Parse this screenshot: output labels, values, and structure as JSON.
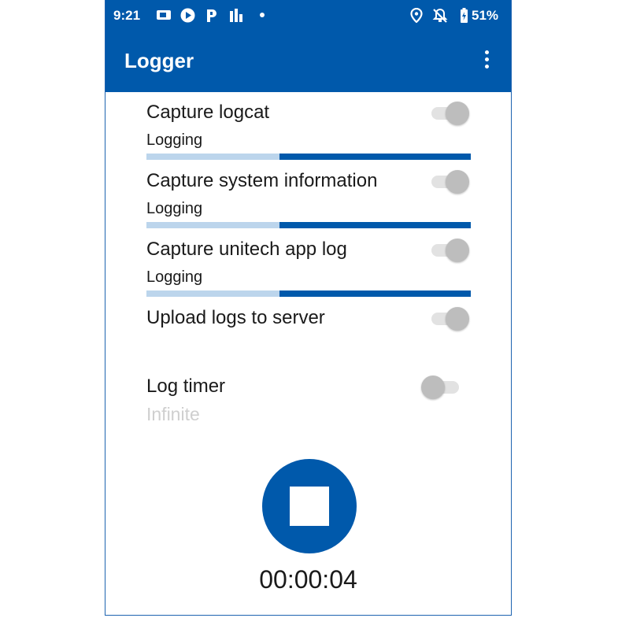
{
  "statusbar": {
    "time": "9:21",
    "battery": "51%",
    "left_icons": [
      "video-icon",
      "play-icon",
      "parking-icon",
      "chart-icon",
      "dot-icon"
    ],
    "right_icons": [
      "location-icon",
      "bell-off-icon",
      "battery-icon"
    ]
  },
  "appbar": {
    "title": "Logger",
    "menu_icon": "overflow-menu-icon"
  },
  "settings": [
    {
      "label": "Capture logcat",
      "sub": "Logging",
      "enabled": true,
      "progress": 0.41
    },
    {
      "label": "Capture system information",
      "sub": "Logging",
      "enabled": true,
      "progress": 0.41
    },
    {
      "label": "Capture unitech app log",
      "sub": "Logging",
      "enabled": true,
      "progress": 0.41
    },
    {
      "label": "Upload logs to server",
      "enabled": true
    }
  ],
  "log_timer": {
    "label": "Log timer",
    "sub": "Infinite",
    "enabled": false
  },
  "stop_button": {
    "icon": "stop-icon"
  },
  "elapsed": "00:00:04",
  "colors": {
    "primary": "#0059ab",
    "progress_track": "#bcd5ec",
    "switch_thumb": "#bdbdbd"
  }
}
